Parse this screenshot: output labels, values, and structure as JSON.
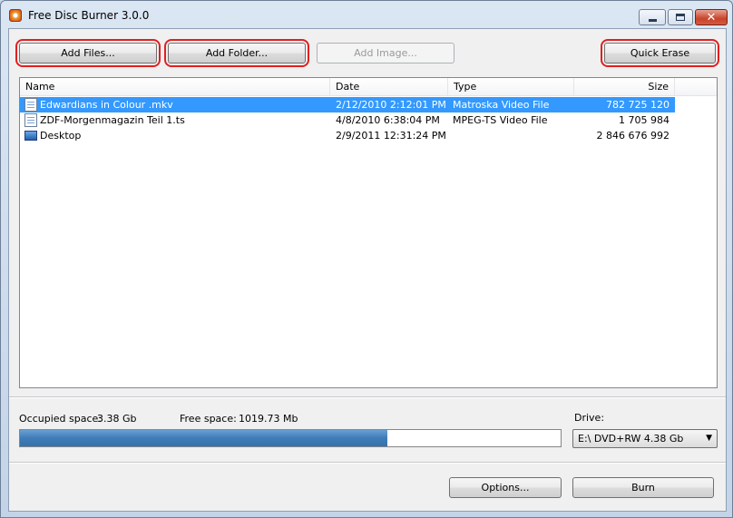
{
  "window": {
    "title": "Free Disc Burner  3.0.0",
    "controls": {
      "minimize": "minimize",
      "maximize": "maximize",
      "close": "✕"
    }
  },
  "toolbar": {
    "add_files": "Add Files...",
    "add_folder": "Add Folder...",
    "add_image": "Add Image...",
    "quick_erase": "Quick Erase"
  },
  "file_list": {
    "columns": {
      "name": "Name",
      "date": "Date",
      "type": "Type",
      "size": "Size"
    },
    "rows": [
      {
        "name": "Edwardians in Colour .mkv",
        "date": "2/12/2010 2:12:01 PM",
        "type": "Matroska Video File",
        "size": "782 725 120",
        "icon": "video-file-icon",
        "selected": true
      },
      {
        "name": "ZDF-Morgenmagazin Teil 1.ts",
        "date": "4/8/2010 6:38:04 PM",
        "type": "MPEG-TS Video File",
        "size": "1 705 984",
        "icon": "video-file-icon",
        "selected": false
      },
      {
        "name": "Desktop",
        "date": "2/9/2011 12:31:24 PM",
        "type": "",
        "size": "2 846 676 992",
        "icon": "folder-icon",
        "selected": false
      }
    ]
  },
  "status": {
    "occupied_label": "Occupied space:",
    "occupied_value": "3.38 Gb",
    "free_label": "Free space:",
    "free_value": "1019.73 Mb",
    "usage_fraction": 0.68
  },
  "drive": {
    "label": "Drive:",
    "selected": "E:\\ DVD+RW 4.38 Gb"
  },
  "footer": {
    "options": "Options...",
    "burn": "Burn"
  },
  "colors": {
    "selection": "#3399ff",
    "progress": "#4a86c2",
    "highlight": "#e02020"
  }
}
